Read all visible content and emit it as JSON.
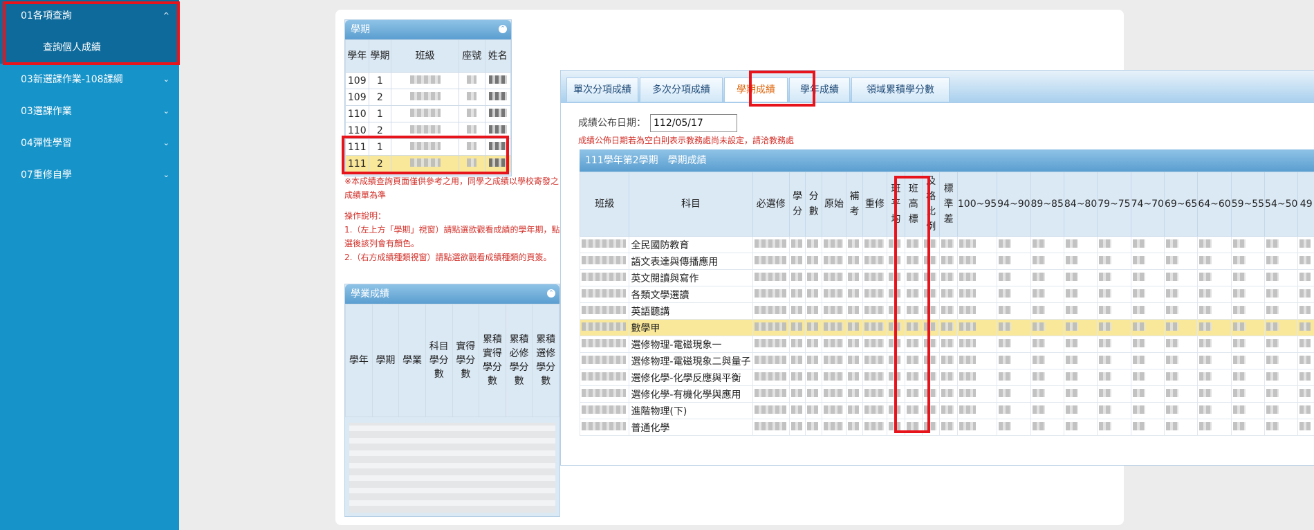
{
  "sidebar": {
    "items": [
      {
        "label": "01各項查詢",
        "chevron": "^"
      },
      {
        "label": "03新選課作業-108課綱",
        "chevron": "⌄"
      },
      {
        "label": "03選課作業",
        "chevron": "⌄"
      },
      {
        "label": "04彈性學習",
        "chevron": "⌄"
      },
      {
        "label": "07重修自學",
        "chevron": "⌄"
      }
    ],
    "submenu": {
      "label": "查詢個人成績"
    }
  },
  "semester_panel": {
    "title": "學期",
    "headers": [
      "學年",
      "學期",
      "班級",
      "座號",
      "姓名"
    ],
    "rows": [
      {
        "year": "109",
        "term": "1"
      },
      {
        "year": "109",
        "term": "2"
      },
      {
        "year": "110",
        "term": "1"
      },
      {
        "year": "110",
        "term": "2"
      },
      {
        "year": "111",
        "term": "1"
      },
      {
        "year": "111",
        "term": "2"
      }
    ],
    "selected": "111-2"
  },
  "notes": {
    "disclaimer": "※本成績查詢頁面僅供參考之用，同學之成績以學校寄發之成績單為準",
    "ops_title": "操作說明：",
    "op1": "1.（左上方「學期」視窗）請點選欲觀看成績的學年期，點選後該列會有顏色。",
    "op2": "2.（右方成績種類視窗）請點選欲觀看成績種類的頁簽。"
  },
  "academic_panel": {
    "title": "學業成績",
    "headers": [
      "學年",
      "學期",
      "學業",
      "科目學分數",
      "實得學分數",
      "累積實得學分數",
      "累積必修學分數",
      "累積選修學分數"
    ]
  },
  "grades": {
    "tabs": [
      "單次分項成績",
      "多次分項成績",
      "學期成績",
      "學年成績",
      "領域累積學分數"
    ],
    "active_tab": "學期成績",
    "publish_label": "成績公布日期：",
    "publish_date": "112/05/17",
    "publish_note": "成績公佈日期若為空白則表示教務處尚未設定，請洽教務處",
    "semester_title": "111學年第2學期　學期成績",
    "headers": [
      "班級",
      "科目",
      "必選修",
      "學分",
      "分數",
      "原始",
      "補考",
      "重修",
      "班平均",
      "班高標",
      "及格比例",
      "標準差",
      "100~95",
      "94~90",
      "89~85",
      "84~80",
      "79~75",
      "74~70",
      "69~65",
      "64~60",
      "59~55",
      "54~50",
      "49"
    ],
    "subjects": [
      "全民國防教育",
      "語文表達與傳播應用",
      "英文閱讀與寫作",
      "各類文學選讀",
      "英語聽講",
      "數學甲",
      "選修物理-電磁現象一",
      "選修物理-電磁現象二與量子",
      "選修化學-化學反應與平衡",
      "選修化學-有機化學與應用",
      "進階物理(下)",
      "普通化學"
    ],
    "selected_subject": "數學甲"
  }
}
